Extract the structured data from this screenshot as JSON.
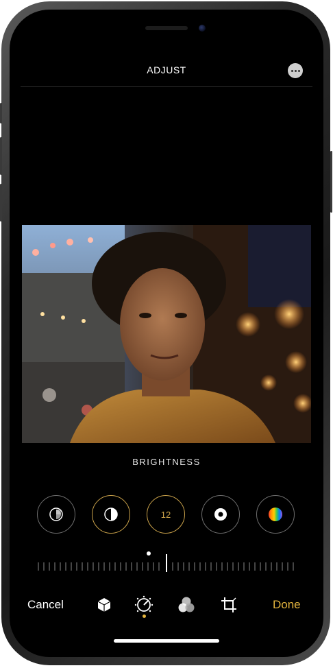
{
  "header": {
    "title": "ADJUST",
    "more_icon": "ellipsis-icon"
  },
  "photo": {
    "subject": "portrait-photo"
  },
  "adjustment": {
    "label": "BRIGHTNESS",
    "value": "12",
    "tools": [
      {
        "name": "auto-enhance-icon"
      },
      {
        "name": "exposure-icon"
      },
      {
        "name": "brightness-value"
      },
      {
        "name": "highlights-icon"
      },
      {
        "name": "saturation-icon"
      }
    ]
  },
  "bottom": {
    "cancel_label": "Cancel",
    "done_label": "Done",
    "icons": [
      "live-photo-icon",
      "adjust-dial-icon",
      "filters-icon",
      "crop-icon"
    ]
  },
  "colors": {
    "accent": "#e3b43e",
    "background": "#000000",
    "text": "#ffffff"
  }
}
